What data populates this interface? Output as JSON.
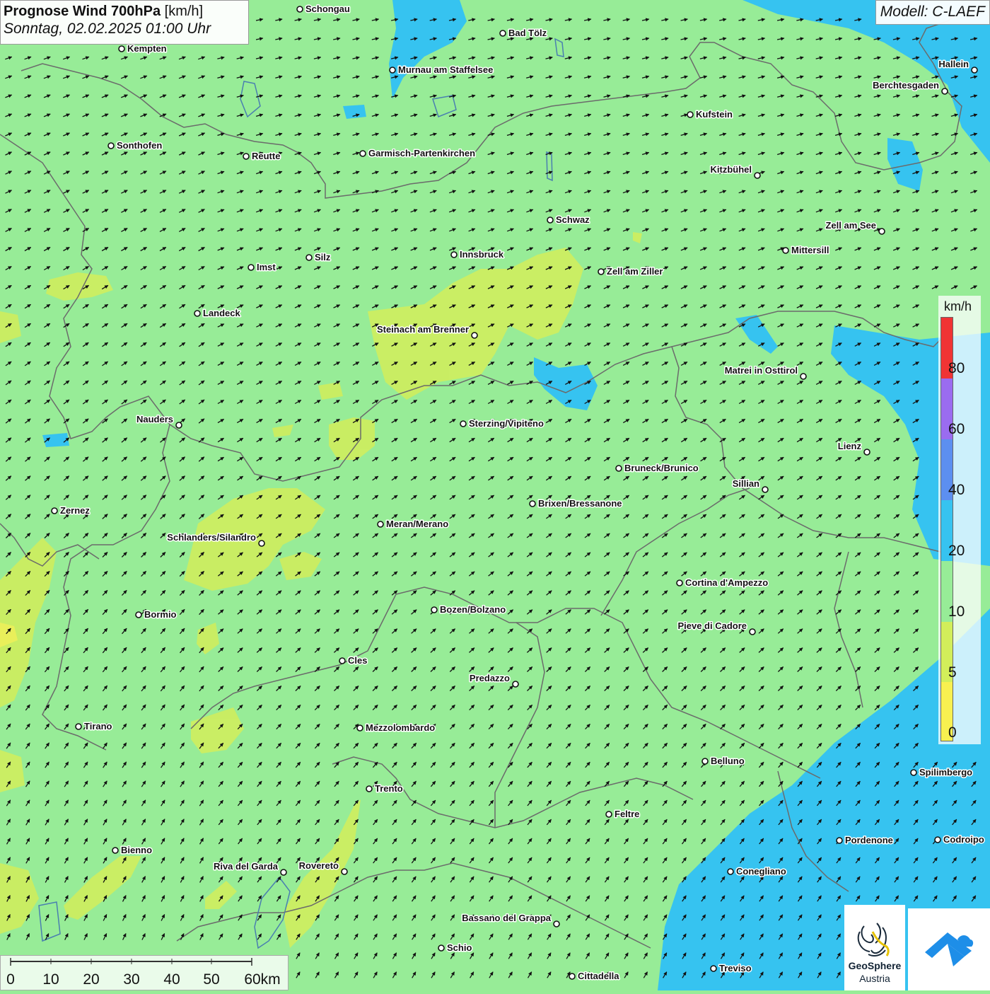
{
  "title": {
    "main": "Prognose Wind 700hPa",
    "unit": "[km/h]",
    "datetime": "Sonntag, 02.02.2025 01:00 Uhr"
  },
  "model": "Modell: C-LAEF",
  "legend": {
    "unit": "km/h",
    "ticks": [
      "80",
      "60",
      "40",
      "20",
      "10",
      "5",
      "0"
    ],
    "colors": {
      "0-5": "#f8f050",
      "5-10": "#d2ee5a",
      "10-20": "#97ec97",
      "20-40": "#36c3f0",
      "40-60": "#5c8ff0",
      "60-80": "#9a6cf0",
      "80+": "#f03434"
    }
  },
  "scalebar": {
    "labels": [
      "0",
      "10",
      "20",
      "30",
      "40",
      "50",
      "60km"
    ]
  },
  "logos": {
    "geosphere_line1": "GeoSphere",
    "geosphere_line2": "Austria"
  },
  "map_style": {
    "base_color": "#97ec97",
    "weak_wind_color": "#d2ee5a",
    "strong_wind_color": "#36c3f0",
    "border_color": "#6b6b6b",
    "arrow_color": "#111111",
    "wind_direction": "from west-southwest to east-northeast"
  },
  "cities": [
    {
      "name": "Schongau"
    },
    {
      "name": "Bad Tölz"
    },
    {
      "name": "Kempten"
    },
    {
      "name": "Murnau am Staffelsee"
    },
    {
      "name": "Hallein"
    },
    {
      "name": "Berchtesgaden"
    },
    {
      "name": "Kufstein"
    },
    {
      "name": "Sonthofen"
    },
    {
      "name": "Reutte"
    },
    {
      "name": "Garmisch-Partenkirchen"
    },
    {
      "name": "Kitzbühel"
    },
    {
      "name": "Schwaz"
    },
    {
      "name": "Zell am See"
    },
    {
      "name": "Mittersill"
    },
    {
      "name": "Silz"
    },
    {
      "name": "Innsbruck"
    },
    {
      "name": "Imst"
    },
    {
      "name": "Zell am Ziller"
    },
    {
      "name": "Landeck"
    },
    {
      "name": "Steinach am Brenner"
    },
    {
      "name": "Matrei in Osttirol"
    },
    {
      "name": "Nauders"
    },
    {
      "name": "Sterzing/Vipiteno"
    },
    {
      "name": "Lienz"
    },
    {
      "name": "Bruneck/Brunico"
    },
    {
      "name": "Sillian"
    },
    {
      "name": "Brixen/Bressanone"
    },
    {
      "name": "Zernez"
    },
    {
      "name": "Meran/Merano"
    },
    {
      "name": "Schlanders/Silandro"
    },
    {
      "name": "Cortina d'Ampezzo"
    },
    {
      "name": "Bormio"
    },
    {
      "name": "Bozen/Bolzano"
    },
    {
      "name": "Pieve di Cadore"
    },
    {
      "name": "Cles"
    },
    {
      "name": "Predazzo"
    },
    {
      "name": "Tirano"
    },
    {
      "name": "Mezzolombardo"
    },
    {
      "name": "Belluno"
    },
    {
      "name": "Spilimbergo"
    },
    {
      "name": "Trento"
    },
    {
      "name": "Feltre"
    },
    {
      "name": "Bienno"
    },
    {
      "name": "Pordenone"
    },
    {
      "name": "Codroipo"
    },
    {
      "name": "Riva del Garda"
    },
    {
      "name": "Rovereto"
    },
    {
      "name": "Conegliano"
    },
    {
      "name": "Bassano del Grappa"
    },
    {
      "name": "Schio"
    },
    {
      "name": "Treviso"
    },
    {
      "name": "Cittadella"
    }
  ]
}
